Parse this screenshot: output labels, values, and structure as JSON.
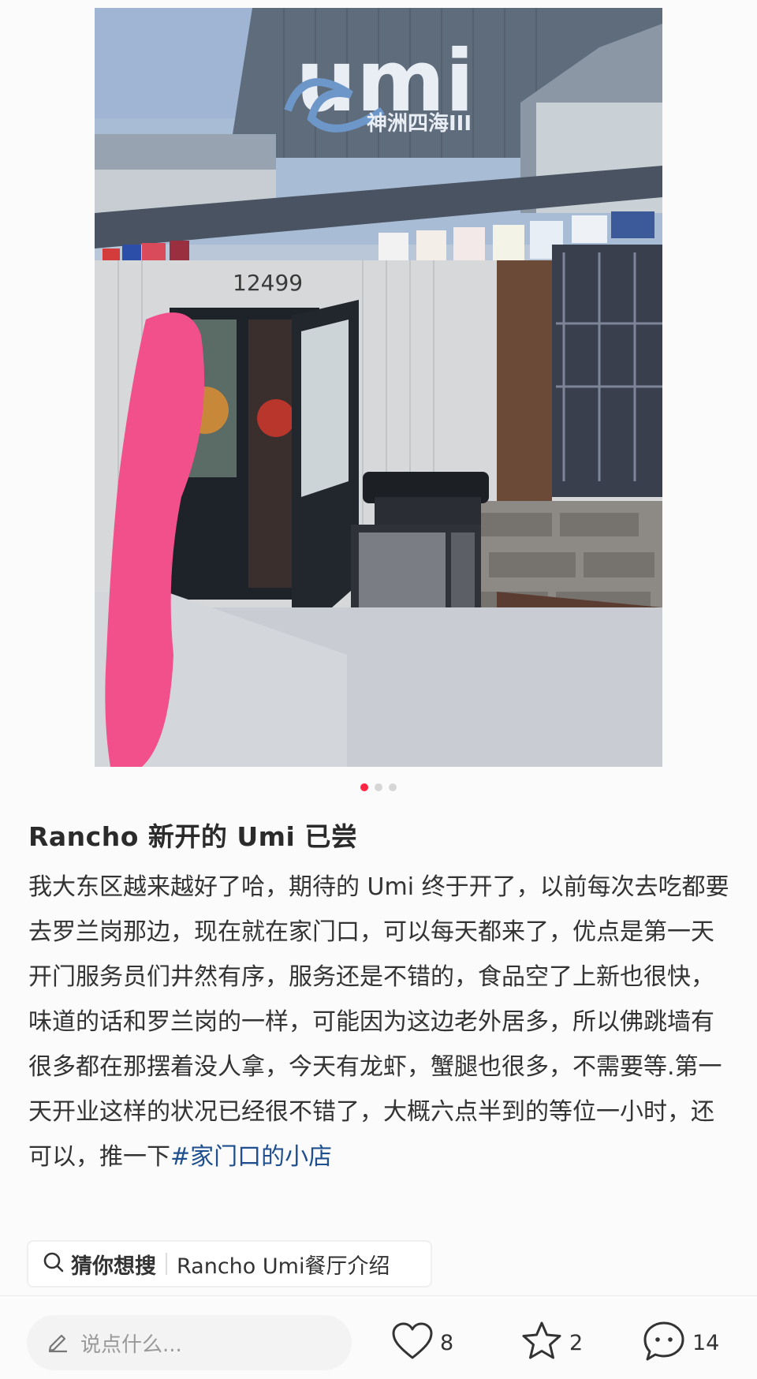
{
  "post": {
    "image": {
      "description_icon": "photo",
      "sign_brand": "umi",
      "sign_subtitle": "神洲四海III",
      "address_number": "12499"
    },
    "carousel": {
      "count": 3,
      "active_index": 0
    },
    "title": "Rancho 新开的 Umi 已尝",
    "body": "我大东区越来越好了哈，期待的 Umi 终于开了，以前每次去吃都要去罗兰岗那边，现在就在家门口，可以每天都来了，优点是第一天开门服务员们井然有序，服务还是不错的，食品空了上新也很快，味道的话和罗兰岗的一样，可能因为这边老外居多，所以佛跳墙有很多都在那摆着没人拿，今天有龙虾，蟹腿也很多，不需要等.第一天开业这样的状况已经很不错了，大概六点半到的等位一小时，还可以，推一下",
    "hashtag": "#家门口的小店"
  },
  "suggest": {
    "icon": "search-icon",
    "label": "猜你想搜",
    "query": "Rancho Umi餐厅介绍"
  },
  "bottom_bar": {
    "comment_placeholder": "说点什么...",
    "likes": "8",
    "favorites": "2",
    "comments": "14"
  },
  "colors": {
    "accent": "#ff2442",
    "hashtag": "#1f4f8f"
  }
}
